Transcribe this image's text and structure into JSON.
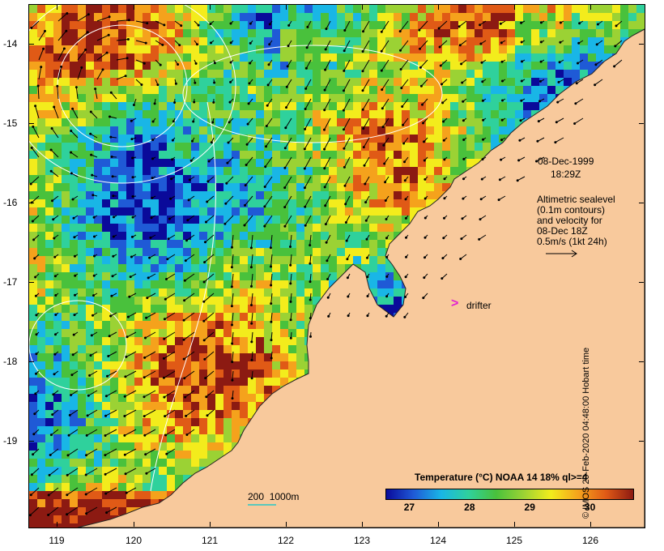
{
  "map": {
    "y_ticks": [
      "-14",
      "-15",
      "-16",
      "-17",
      "-18",
      "-19"
    ],
    "x_ticks": [
      "119",
      "120",
      "121",
      "122",
      "123",
      "124",
      "125",
      "126"
    ],
    "lon_range": [
      118.62,
      126.7
    ],
    "lat_range": [
      -13.58,
      -20.08
    ]
  },
  "annotations": {
    "date": "08-Dec-1999",
    "time": "18:29Z",
    "altimetry_lines": [
      "Altimetric sealevel",
      "(0.1m contours)",
      "and velocity for",
      "08-Dec 18Z",
      "0.5m/s (1kt 24h)"
    ],
    "drifter_symbol": ">",
    "drifter_label": "drifter",
    "depth_contours": "200  1000m"
  },
  "colorbar": {
    "title": "Temperature (°C) NOAA 14 18% ql>=4",
    "ticks": [
      "27",
      "28",
      "29",
      "30"
    ],
    "range": [
      26.6,
      30.7
    ],
    "colors": [
      "#0a0a9a",
      "#1f5ad6",
      "#19b6e6",
      "#2fd19c",
      "#49c13c",
      "#9bd234",
      "#f3ec1c",
      "#f5a21c",
      "#e05a16",
      "#8c1a12"
    ]
  },
  "credit": "© IMOS 29-Feb-2020 04:48:00 Hobart time",
  "colors": {
    "land": "#f8c99c",
    "vector": "#000000",
    "contour": "#ffffff",
    "drifter": "#e11ed2",
    "depth_line": "#26c7c7"
  }
}
